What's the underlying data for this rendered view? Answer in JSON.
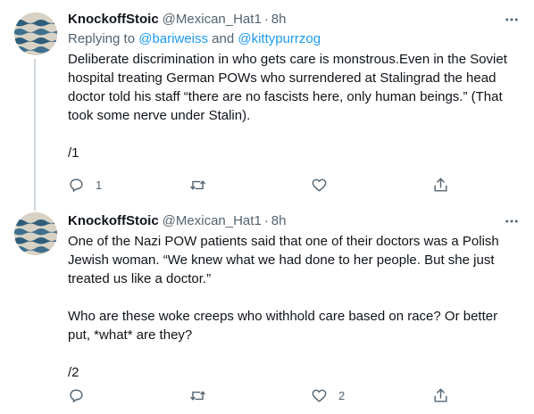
{
  "tweets": [
    {
      "display_name": "KnockoffStoic",
      "handle": "@Mexican_Hat1",
      "separator": "·",
      "time": "8h",
      "replying_prefix": "Replying to ",
      "mention_1": "@bariweiss",
      "replying_and": " and ",
      "mention_2": "@kittypurrzog",
      "text": "Deliberate discrimination in who gets care is monstrous.Even in the Soviet hospital treating German POWs who surrendered at Stalingrad the head doctor told his staff “there are no fascists here, only human beings.” (That took some nerve under Stalin).\n\n/1",
      "reply_count": "1",
      "retweet_count": "",
      "like_count": ""
    },
    {
      "display_name": "KnockoffStoic",
      "handle": "@Mexican_Hat1",
      "separator": "·",
      "time": "8h",
      "text": "One of the Nazi POW patients said that one of their doctors was a Polish Jewish woman. “We knew what we had done to her people. But she just treated us like a doctor.”\n\nWho are these woke creeps who withhold care based on race? Or better put, *what* are they?\n\n/2",
      "reply_count": "",
      "retweet_count": "",
      "like_count": "2"
    }
  ],
  "colors": {
    "accent": "#1d9bf0",
    "text_primary": "#0f1419",
    "text_secondary": "#536471",
    "thread_line": "#cfd9de"
  },
  "icons": {
    "more": "more-horizontal-icon",
    "reply": "reply-icon",
    "retweet": "retweet-icon",
    "like": "heart-icon",
    "share": "share-icon"
  }
}
